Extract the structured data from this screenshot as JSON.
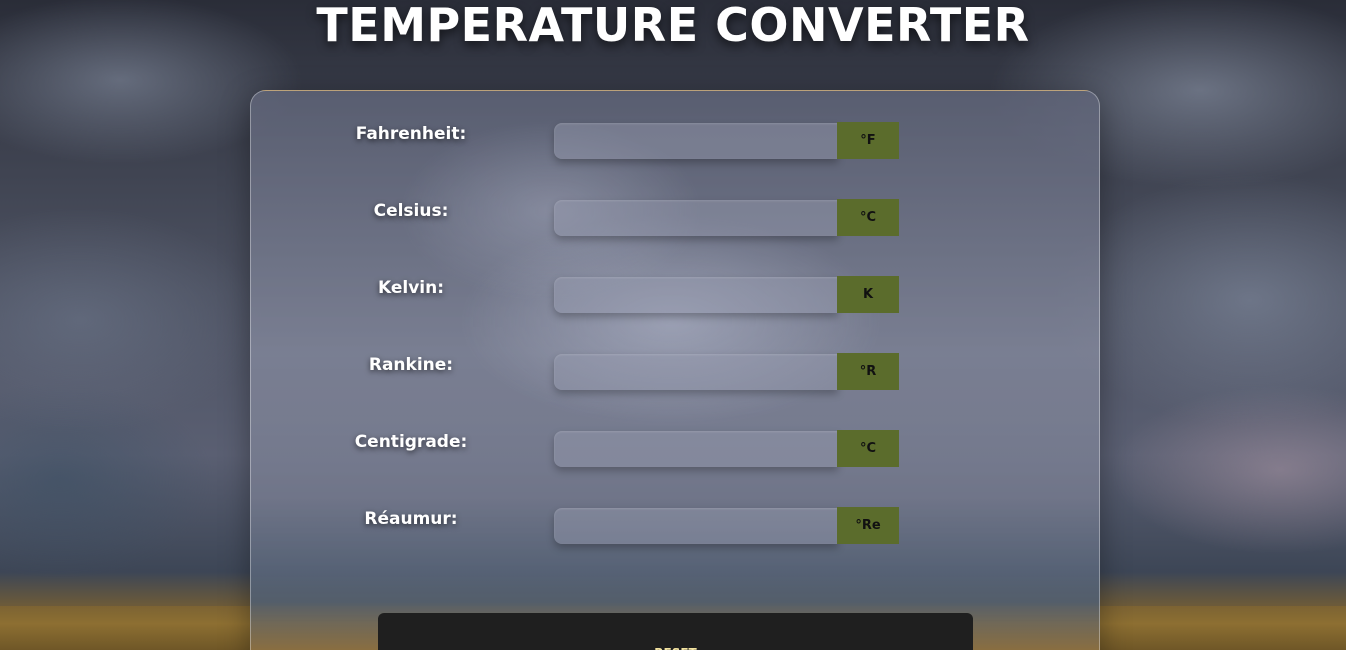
{
  "page": {
    "title": "TEMPERATURE CONVERTER"
  },
  "converter": {
    "rows": [
      {
        "label": "Fahrenheit:",
        "value": "",
        "unit": "°F"
      },
      {
        "label": "Celsius:",
        "value": "",
        "unit": "°C"
      },
      {
        "label": "Kelvin:",
        "value": "",
        "unit": "K"
      },
      {
        "label": "Rankine:",
        "value": "",
        "unit": "°R"
      },
      {
        "label": "Centigrade:",
        "value": "",
        "unit": "°C"
      },
      {
        "label": "Réaumur:",
        "value": "",
        "unit": "°Re"
      }
    ],
    "reset_label": "RESET"
  },
  "colors": {
    "unit_badge": "#5b6c2c",
    "reset_button": "#1f1f1f",
    "reset_text": "#f3e3a0"
  }
}
